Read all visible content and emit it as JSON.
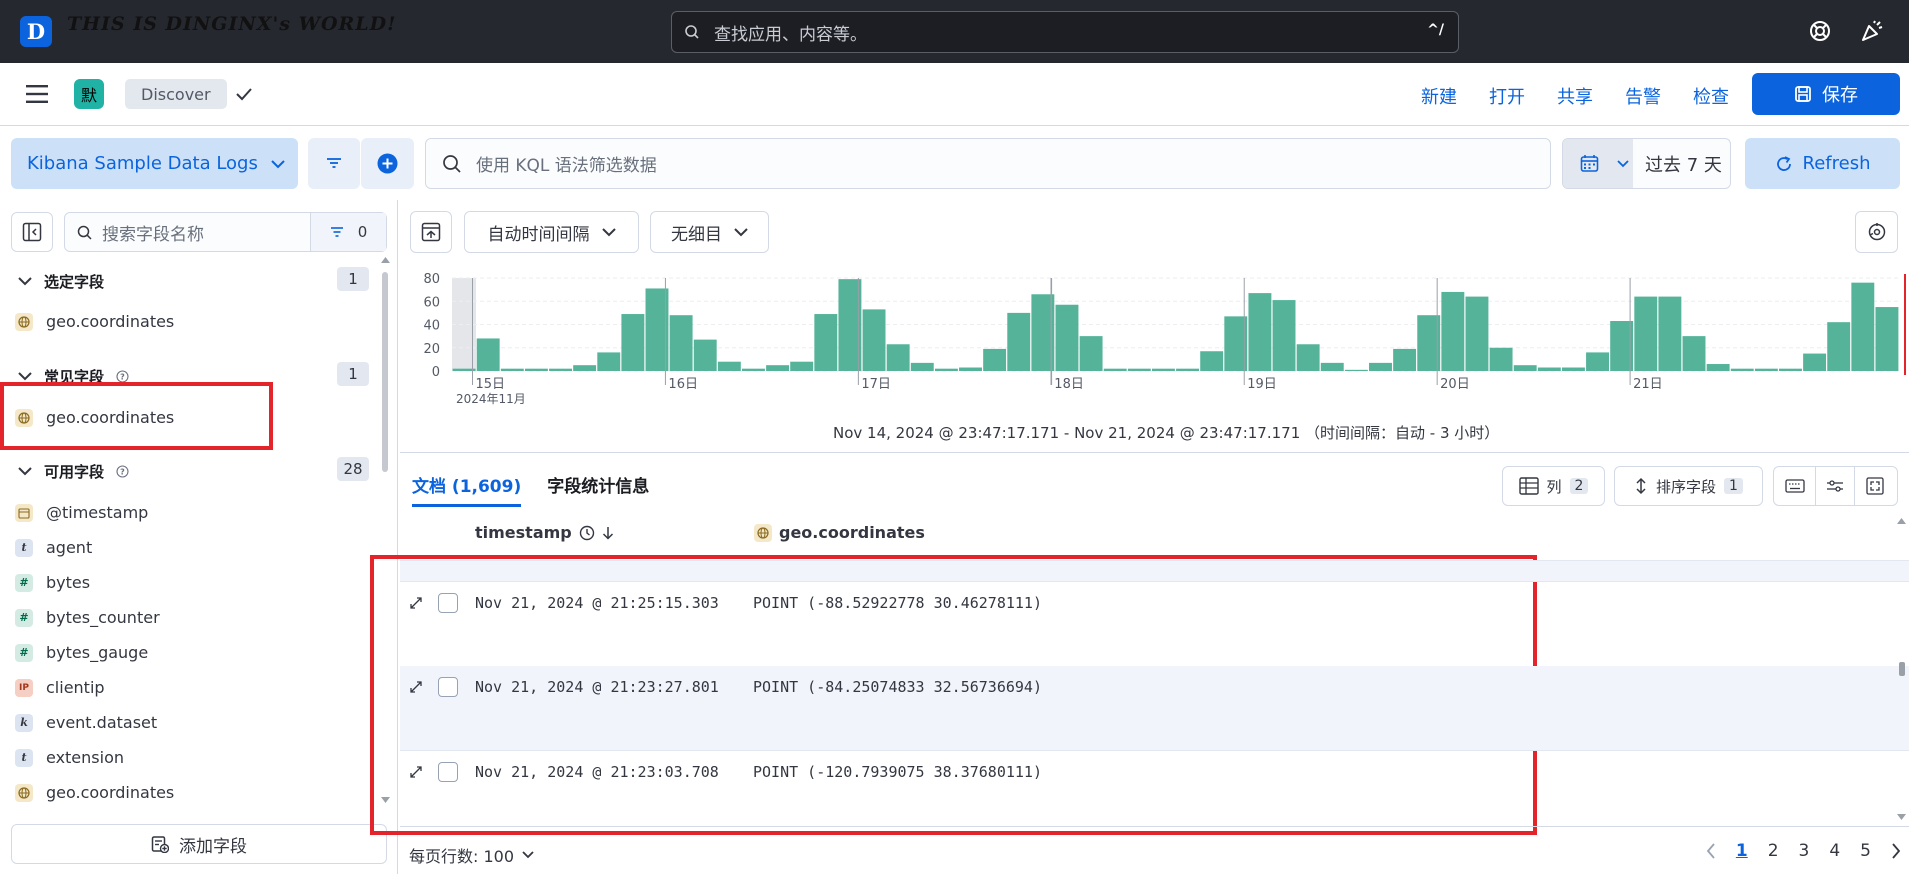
{
  "header": {
    "brand": "THIS IS DINGINX's WORLD!",
    "logo_letter": "D",
    "search_placeholder": "查找应用、内容等。",
    "search_shortcut": "^/"
  },
  "appbar": {
    "space_avatar": "默",
    "breadcrumb": "Discover",
    "actions": [
      "新建",
      "打开",
      "共享",
      "告警",
      "检查"
    ],
    "save_label": "保存"
  },
  "querybar": {
    "data_view": "Kibana Sample Data Logs",
    "kql_placeholder": "使用 KQL 语法筛选数据",
    "date_range": "过去 7 天",
    "refresh_label": "Refresh"
  },
  "sidebar": {
    "search_placeholder": "搜索字段名称",
    "filter_count": "0",
    "selected": {
      "title": "选定字段",
      "count": "1",
      "fields": [
        {
          "name": "geo.coordinates",
          "type": "geo"
        }
      ]
    },
    "popular": {
      "title": "常见字段",
      "count": "1",
      "fields": [
        {
          "name": "geo.coordinates",
          "type": "geo"
        }
      ]
    },
    "available": {
      "title": "可用字段",
      "count": "28",
      "fields": [
        {
          "name": "@timestamp",
          "type": "date",
          "glyph": ""
        },
        {
          "name": "agent",
          "type": "string",
          "glyph": "t"
        },
        {
          "name": "bytes",
          "type": "number",
          "glyph": "#"
        },
        {
          "name": "bytes_counter",
          "type": "number",
          "glyph": "#"
        },
        {
          "name": "bytes_gauge",
          "type": "number",
          "glyph": "#"
        },
        {
          "name": "clientip",
          "type": "ip",
          "glyph": "IP"
        },
        {
          "name": "event.dataset",
          "type": "keyword",
          "glyph": "k"
        },
        {
          "name": "extension",
          "type": "string",
          "glyph": "t"
        },
        {
          "name": "geo.coordinates",
          "type": "geo",
          "glyph": ""
        }
      ]
    },
    "add_field_label": "添加字段"
  },
  "histogram": {
    "interval_label": "自动时间间隔",
    "breakdown_label": "无细目",
    "time_range_text": "Nov 14, 2024 @ 23:47:17.171 - Nov 21, 2024 @ 23:47:17.171 （时间间隔：自动 - 3 小时）",
    "y_ticks": [
      "80",
      "60",
      "40",
      "20",
      "0"
    ],
    "x_ticks": [
      "15日",
      "16日",
      "17日",
      "18日",
      "19日",
      "20日",
      "21日"
    ],
    "x_sub": "2024年11月",
    "values": [
      2,
      28,
      2,
      2,
      2,
      5,
      16,
      49,
      71,
      48,
      27,
      8,
      2,
      5,
      8,
      49,
      79,
      53,
      23,
      7,
      2,
      3,
      19,
      50,
      66,
      57,
      30,
      2,
      2,
      2,
      2,
      17,
      47,
      67,
      61,
      23,
      7,
      1,
      7,
      19,
      48,
      68,
      64,
      20,
      5,
      3,
      3,
      16,
      43,
      64,
      64,
      30,
      6,
      2,
      2,
      2,
      15,
      42,
      76,
      55
    ],
    "bar_color": "#54b399"
  },
  "documents": {
    "tab_docs": "文档 (1,609)",
    "tab_stats": "字段统计信息",
    "columns_label": "列",
    "columns_count": "2",
    "sort_label": "排序字段",
    "sort_count": "1",
    "col_timestamp": "timestamp",
    "col_geo": "geo.coordinates",
    "rows": [
      {
        "timestamp": "Nov 21, 2024 @ 21:25:15.303",
        "geo": "POINT (-88.52922778 30.46278111)"
      },
      {
        "timestamp": "Nov 21, 2024 @ 21:23:27.801",
        "geo": "POINT (-84.25074833 32.56736694)"
      },
      {
        "timestamp": "Nov 21, 2024 @ 21:23:03.708",
        "geo": "POINT (-120.7939075 38.37680111)"
      }
    ],
    "rows_per_page": "每页行数: 100",
    "pages": [
      "1",
      "2",
      "3",
      "4",
      "5"
    ]
  }
}
